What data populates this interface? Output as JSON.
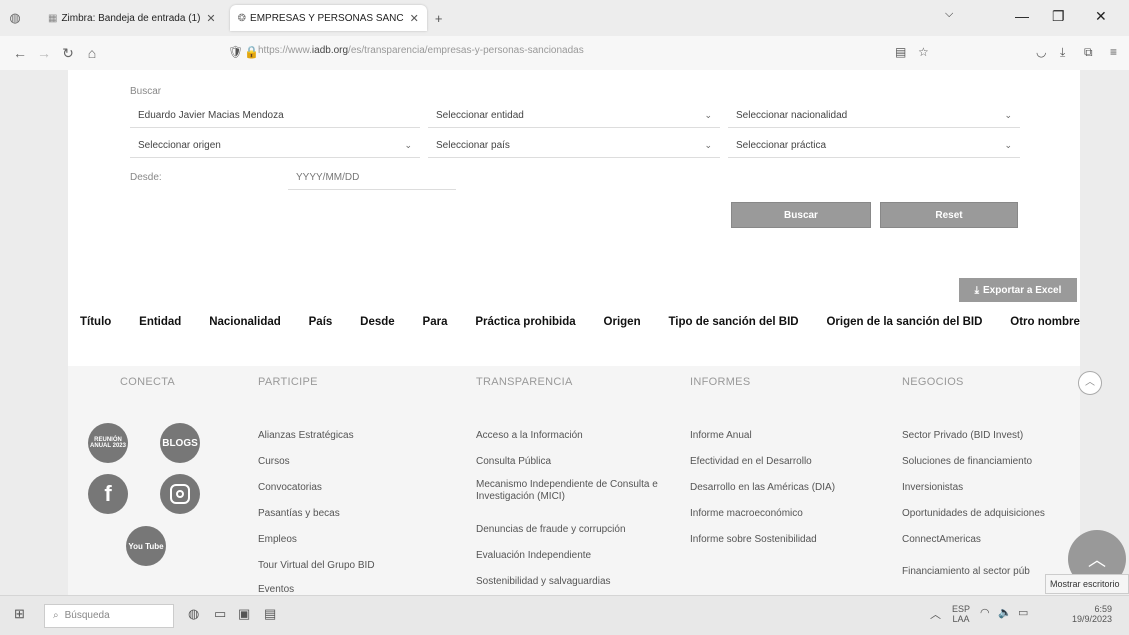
{
  "browser": {
    "tabs": [
      {
        "title": "Zimbra: Bandeja de entrada (1)",
        "active": false
      },
      {
        "title": "EMPRESAS Y PERSONAS SANC",
        "active": true
      }
    ],
    "new_tab": "+",
    "url_prefix": "https://www.",
    "url_domain": "iadb.org",
    "url_path": "/es/transparencia/empresas-y-personas-sancionadas"
  },
  "search": {
    "label": "Buscar",
    "query_value": "Eduardo Javier Macias Mendoza",
    "entity_select": "Seleccionar entidad",
    "nationality_select": "Seleccionar nacionalidad",
    "origin_select": "Seleccionar origen",
    "country_select": "Seleccionar país",
    "practice_select": "Seleccionar práctica",
    "from_label": "Desde:",
    "date_placeholder": "YYYY/MM/DD",
    "search_button": "Buscar",
    "reset_button": "Reset",
    "export_button": "Exportar a Excel"
  },
  "table": {
    "columns": [
      "Título",
      "Entidad",
      "Nacionalidad",
      "País",
      "Desde",
      "Para",
      "Práctica prohibida",
      "Origen",
      "Tipo de sanción del BID",
      "Origen de la sanción del BID",
      "Otro nombre"
    ]
  },
  "footer": {
    "conecta": {
      "heading": "CONECTA",
      "social": [
        "REUNIÓN ANUAL 2023",
        "BLOGS",
        "f",
        "instagram",
        "You Tube"
      ]
    },
    "participe": {
      "heading": "PARTICIPE",
      "links": [
        "Alianzas Estratégicas",
        "Cursos",
        "Convocatorias",
        "Pasantías y becas",
        "Empleos",
        "Tour Virtual del Grupo BID",
        "Eventos"
      ]
    },
    "transparencia": {
      "heading": "TRANSPARENCIA",
      "links": [
        "Acceso a la Información",
        "Consulta Pública",
        "Mecanismo Independiente de Consulta e Investigación (MICI)",
        "Denuncias de fraude y corrupción",
        "Evaluación Independiente",
        "Sostenibilidad y salvaguardias"
      ]
    },
    "informes": {
      "heading": "INFORMES",
      "links": [
        "Informe Anual",
        "Efectividad en el Desarrollo",
        "Desarrollo en las Américas (DIA)",
        "Informe macroeconómico",
        "Informe sobre Sostenibilidad"
      ]
    },
    "negocios": {
      "heading": "NEGOCIOS",
      "links": [
        "Sector Privado (BID Invest)",
        "Soluciones de financiamiento",
        "Inversionistas",
        "Oportunidades de adquisiciones",
        "ConnectAmericas",
        "Financiamiento al sector púb"
      ]
    }
  },
  "tooltip": "Mostrar escritorio",
  "taskbar": {
    "search_placeholder": "Búsqueda",
    "lang": "ESP",
    "lang_sub": "LAA",
    "time": "6:59",
    "date": "19/9/2023"
  }
}
